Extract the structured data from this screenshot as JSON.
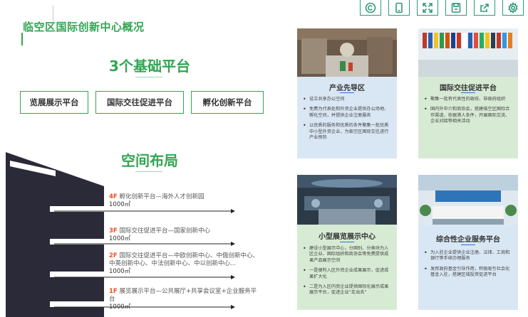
{
  "toolbar": {
    "icons": [
      "copyright-icon",
      "mobile-icon",
      "fullscreen-icon",
      "save-icon",
      "share-icon",
      "settings-icon"
    ]
  },
  "page": {
    "title": "临空区国际创新中心概况"
  },
  "platforms": {
    "heading": "3个基础平台",
    "items": [
      "览展展示平台",
      "国际交往促进平台",
      "孵化创新平台"
    ]
  },
  "layout": {
    "heading": "空间布局",
    "floors": [
      {
        "num": "4F",
        "text": "孵化创新平台—海外人才创新园",
        "area": "1000㎡"
      },
      {
        "num": "3F",
        "text": "国际交往促进平台—国家创新中心",
        "area": "1000㎡"
      },
      {
        "num": "2F",
        "text": "国际交往促进平台—中欧创新中心、中俄创新中心、中英创新中心、中法创新中心、中以创新中心...",
        "area": "1000㎡"
      },
      {
        "num": "1F",
        "text": "展览展示平台—公共展厅+共享会议室+企业服务平台",
        "area": "1000㎡"
      }
    ]
  },
  "cards": [
    {
      "title": "产业先导区",
      "bullets": [
        "设立共享办公空间",
        "免费为代表处和外资企业提供办公场地、孵化空间，并提供企业注册服务",
        "以优质的服务和优质的条件聚集一批优质中小型外资企业，为临空区国际交往进行产业预热"
      ]
    },
    {
      "title": "国际交往促进平台",
      "bullets": [
        "聚集一批有代表性的政府、非政府组织",
        "国内外中介和商协会，搭建临空区国际合作渠道，依据港人条件，开展国际交流、企业对接等相关活动"
      ]
    },
    {
      "title": "小型展览展示中心",
      "bullets": [
        "建设小型展示中心，分国别、分类块为入区企业、国际组织和商协会等免费提供成果产品展示空间",
        "一是便利入区外资企业成果展示，促进成果扩大化",
        "二是为入区内资企业提供国际化展示成果展示平台，促进企业“走出去”"
      ]
    },
    {
      "title": "综合性企业服务平台",
      "bullets": [
        "为入驻企业提供企业注册、法律、工商和银行等手续办理服务",
        "发挥政府基金引导作用，积极吸引社会化基金入驻，搭建区域投资促进平台"
      ]
    }
  ]
}
